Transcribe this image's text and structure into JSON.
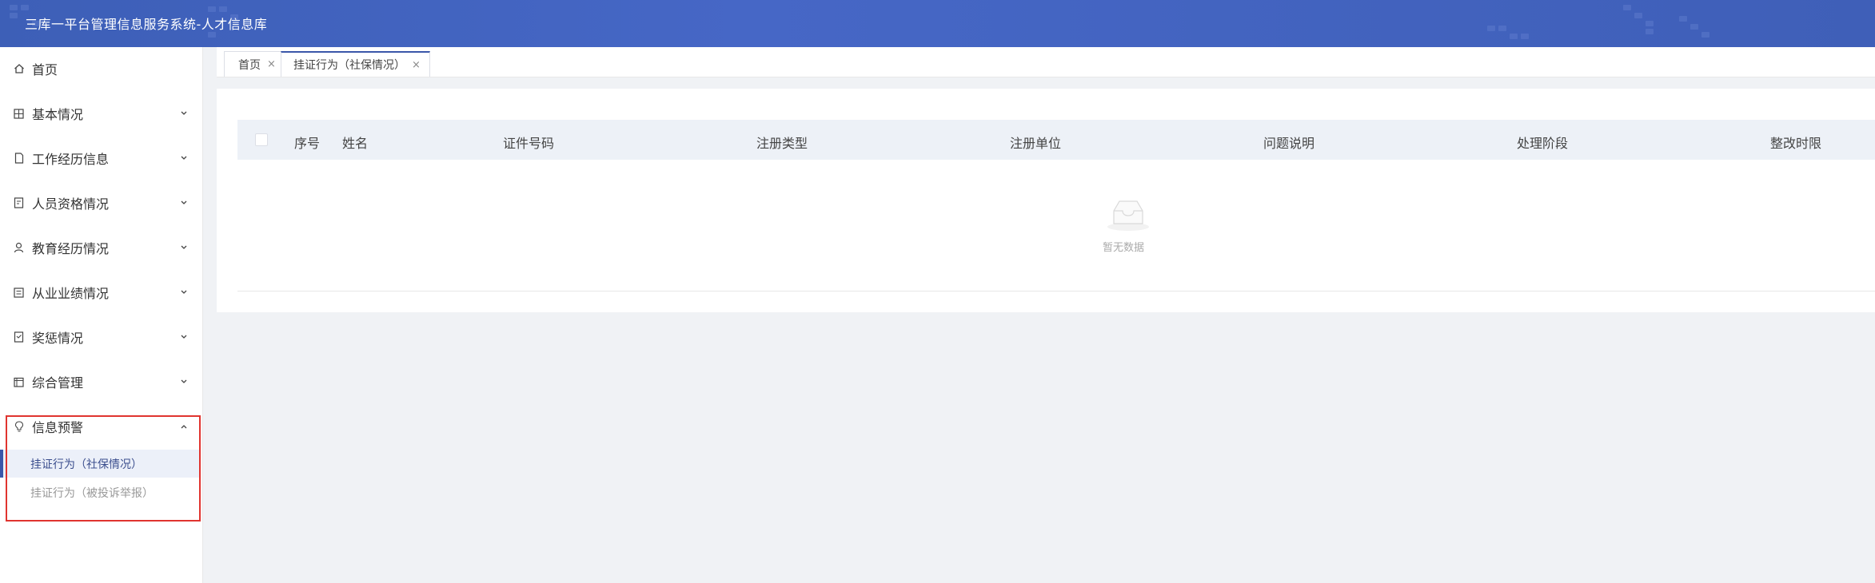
{
  "header": {
    "title": "三库一平台管理信息服务系统-人才信息库"
  },
  "sidebar": {
    "items": [
      {
        "label": "首页",
        "icon": "home-icon"
      },
      {
        "label": "基本情况",
        "icon": "grid-icon"
      },
      {
        "label": "工作经历信息",
        "icon": "document-icon"
      },
      {
        "label": "人员资格情况",
        "icon": "certificate-icon"
      },
      {
        "label": "教育经历情况",
        "icon": "user-icon"
      },
      {
        "label": "从业业绩情况",
        "icon": "list-icon"
      },
      {
        "label": "奖惩情况",
        "icon": "award-icon"
      },
      {
        "label": "综合管理",
        "icon": "calendar-icon"
      },
      {
        "label": "信息预警",
        "icon": "bulb-icon"
      }
    ],
    "sub_items": [
      {
        "label": "挂证行为（社保情况）",
        "active": true
      },
      {
        "label": "挂证行为（被投诉举报）",
        "active": false
      }
    ]
  },
  "tabs": [
    {
      "label": "首页",
      "close": "×"
    },
    {
      "label": "挂证行为（社保情况）",
      "close": "×"
    }
  ],
  "table": {
    "columns": [
      "序号",
      "姓名",
      "证件号码",
      "注册类型",
      "注册单位",
      "问题说明",
      "处理阶段",
      "整改时限"
    ],
    "rows": [],
    "empty_text": "暂无数据"
  },
  "colors": {
    "header": "#4667c6",
    "accent": "#3a56a9",
    "highlight": "#e0342f"
  }
}
